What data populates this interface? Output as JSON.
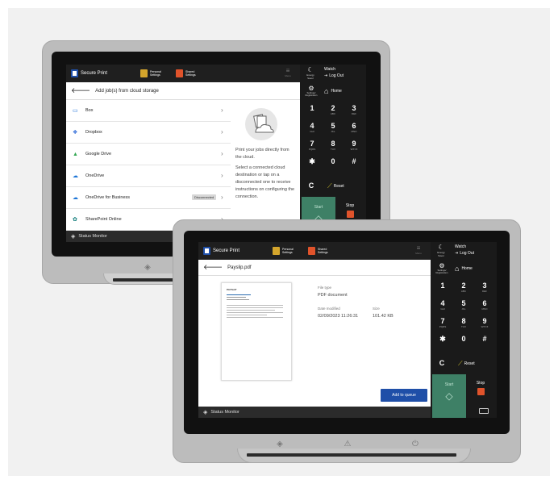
{
  "back_device": {
    "header": {
      "app_name": "Secure Print",
      "personal_settings": "Personal Settings",
      "shared_settings": "Shared Settings",
      "menu_label": "Menu"
    },
    "side": {
      "energy_saver": "Energy Saver",
      "user": "Watch",
      "logout": "Log Out",
      "settings_registration": "Settings/ Registration",
      "home": "Home"
    },
    "title": "Add job(s) from cloud storage",
    "list": [
      {
        "label": "Box",
        "icon_color": "#1e6fd9"
      },
      {
        "label": "Dropbox",
        "icon_color": "#2d6ad8"
      },
      {
        "label": "Google Drive",
        "icon_color": "#34a853"
      },
      {
        "label": "OneDrive",
        "icon_color": "#1a73d6"
      },
      {
        "label": "OneDrive for Business",
        "icon_color": "#1a73d6",
        "badge": "Disconnected"
      },
      {
        "label": "SharePoint Online",
        "icon_color": "#0c7a78"
      }
    ],
    "info_title": "Print your jobs directly from the cloud.",
    "info_body": "Select a connected cloud destination or tap on a disconnected one to receive instructions on configuring the connection.",
    "status": "Status Monitor",
    "keys": [
      {
        "k": "1",
        "s": ""
      },
      {
        "k": "2",
        "s": "ABC"
      },
      {
        "k": "3",
        "s": "DEF"
      },
      {
        "k": "4",
        "s": "GHI"
      },
      {
        "k": "5",
        "s": "JKL"
      },
      {
        "k": "6",
        "s": "MNO"
      },
      {
        "k": "7",
        "s": "PQRS"
      },
      {
        "k": "8",
        "s": "TUV"
      },
      {
        "k": "9",
        "s": "WXYZ"
      },
      {
        "k": "✱",
        "s": ""
      },
      {
        "k": "0",
        "s": ""
      },
      {
        "k": "#",
        "s": ""
      }
    ],
    "clear": "C",
    "reset": "Reset",
    "start": "Start",
    "stop": "Stop"
  },
  "front_device": {
    "header": {
      "app_name": "Secure Print",
      "personal_settings": "Personal Settings",
      "shared_settings": "Shared Settings",
      "menu_label": "Menu"
    },
    "side": {
      "energy_saver": "Energy Saver",
      "user": "Watch",
      "logout": "Log Out",
      "settings_registration": "Settings/ Registration",
      "home": "Home"
    },
    "title": "Payslip.pdf",
    "doc_title": "PAYSLIP",
    "file_type_label": "File type",
    "file_type_value": "PDF document",
    "date_label": "Date modified",
    "date_value": "02/09/2023 11:26:31",
    "size_label": "Size",
    "size_value": "101.42 KB",
    "add_button": "Add to queue",
    "status": "Status Monitor",
    "keys": [
      {
        "k": "1",
        "s": ""
      },
      {
        "k": "2",
        "s": "ABC"
      },
      {
        "k": "3",
        "s": "DEF"
      },
      {
        "k": "4",
        "s": "GHI"
      },
      {
        "k": "5",
        "s": "JKL"
      },
      {
        "k": "6",
        "s": "MNO"
      },
      {
        "k": "7",
        "s": "PQRS"
      },
      {
        "k": "8",
        "s": "TUV"
      },
      {
        "k": "9",
        "s": "WXYZ"
      },
      {
        "k": "✱",
        "s": ""
      },
      {
        "k": "0",
        "s": ""
      },
      {
        "k": "#",
        "s": ""
      }
    ],
    "clear": "C",
    "reset": "Reset",
    "start": "Start",
    "stop": "Stop"
  },
  "colors": {
    "start": "#3e8066",
    "stop": "#e0532b",
    "accent": "#1f4fa8",
    "bezel": "#111111"
  }
}
